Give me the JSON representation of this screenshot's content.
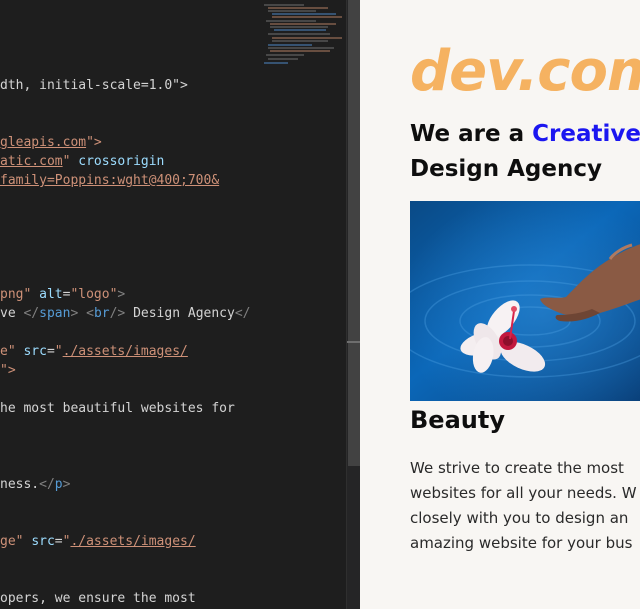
{
  "editor": {
    "code_lines": [
      {
        "parts": [
          {
            "c": "t-text",
            "t": "dth, initial-scale=1.0\">"
          }
        ]
      },
      {
        "parts": [
          {
            "c": "t-url",
            "t": "gleapis.com"
          },
          {
            "c": "t-str",
            "t": "\">"
          }
        ]
      },
      {
        "parts": [
          {
            "c": "t-url",
            "t": "atic.com"
          },
          {
            "c": "t-str",
            "t": "\" "
          },
          {
            "c": "t-attr",
            "t": "crossorigin"
          }
        ]
      },
      {
        "parts": [
          {
            "c": "t-url",
            "t": "family=Poppins:wght@400;700&"
          }
        ]
      },
      {
        "parts": [
          {
            "c": "t-str",
            "t": "png\" "
          },
          {
            "c": "t-attr",
            "t": "alt"
          },
          {
            "c": "t-text",
            "t": "="
          },
          {
            "c": "t-str",
            "t": "\"logo\""
          },
          {
            "c": "t-punct",
            "t": ">"
          }
        ]
      },
      {
        "parts": [
          {
            "c": "t-text",
            "t": "ve "
          },
          {
            "c": "t-punct",
            "t": "</"
          },
          {
            "c": "t-tag",
            "t": "span"
          },
          {
            "c": "t-punct",
            "t": ">"
          },
          {
            "c": "t-text",
            "t": " "
          },
          {
            "c": "t-punct",
            "t": "<"
          },
          {
            "c": "t-tag",
            "t": "br"
          },
          {
            "c": "t-punct",
            "t": "/>"
          },
          {
            "c": "t-text",
            "t": " Design Agency"
          },
          {
            "c": "t-punct",
            "t": "</"
          }
        ]
      },
      {
        "parts": [
          {
            "c": "t-str",
            "t": "e\" "
          },
          {
            "c": "t-attr",
            "t": "src"
          },
          {
            "c": "t-text",
            "t": "="
          },
          {
            "c": "t-str",
            "t": "\""
          },
          {
            "c": "t-url",
            "t": "./assets/images/"
          }
        ]
      },
      {
        "parts": [
          {
            "c": "t-str",
            "t": "\">"
          }
        ]
      },
      {
        "parts": [
          {
            "c": "t-text",
            "t": "he most beautiful websites for"
          }
        ]
      },
      {
        "parts": [
          {
            "c": "t-text",
            "t": "ness."
          },
          {
            "c": "t-punct",
            "t": "</"
          },
          {
            "c": "t-tag",
            "t": "p"
          },
          {
            "c": "t-punct",
            "t": ">"
          }
        ]
      },
      {
        "parts": [
          {
            "c": "t-str",
            "t": "ge\" "
          },
          {
            "c": "t-attr",
            "t": "src"
          },
          {
            "c": "t-text",
            "t": "="
          },
          {
            "c": "t-str",
            "t": "\""
          },
          {
            "c": "t-url",
            "t": "./assets/images/"
          }
        ]
      },
      {
        "parts": [
          {
            "c": "t-text",
            "t": "opers, we ensure the most"
          }
        ]
      }
    ]
  },
  "preview": {
    "logo": "dev.com",
    "headline_prefix": "We are a ",
    "headline_accent": "Creative",
    "headline_line2": "Design Agency",
    "section_title": "Beauty",
    "body_lines": [
      "We strive to create the most",
      "websites for all your needs. W",
      "closely with you to design an",
      "amazing website for your bus"
    ]
  },
  "colors": {
    "logo": "#f5b261",
    "accent": "#1b16f0",
    "editor_bg": "#1e1e1e",
    "preview_bg": "#f8f6f3"
  }
}
